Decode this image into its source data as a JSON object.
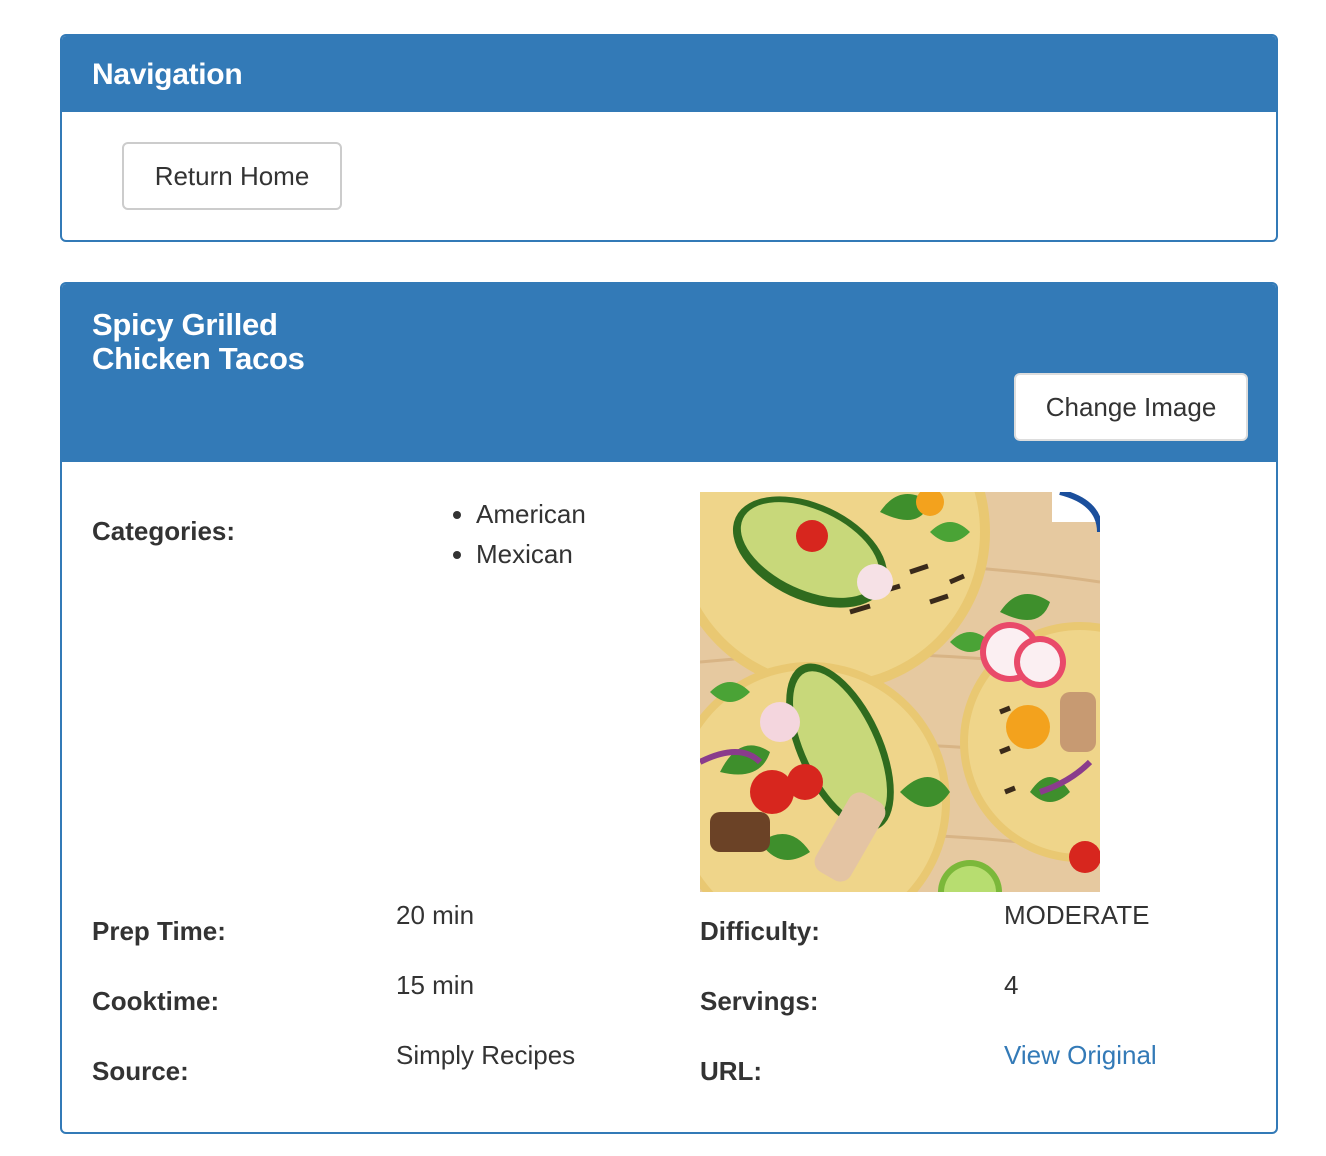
{
  "navigation": {
    "title": "Navigation",
    "return_home_label": "Return Home"
  },
  "recipe": {
    "title": "Spicy Grilled Chicken Tacos",
    "change_image_label": "Change Image",
    "categories_label": "Categories:",
    "categories": [
      "American",
      "Mexican"
    ],
    "prep_time_label": "Prep Time:",
    "prep_time": "20 min",
    "cooktime_label": "Cooktime:",
    "cooktime": "15 min",
    "source_label": "Source:",
    "source": "Simply Recipes",
    "difficulty_label": "Difficulty:",
    "difficulty": "MODERATE",
    "servings_label": "Servings:",
    "servings": "4",
    "url_label": "URL:",
    "url_link_text": "View Original"
  },
  "colors": {
    "primary": "#337ab7",
    "text": "#333333"
  }
}
